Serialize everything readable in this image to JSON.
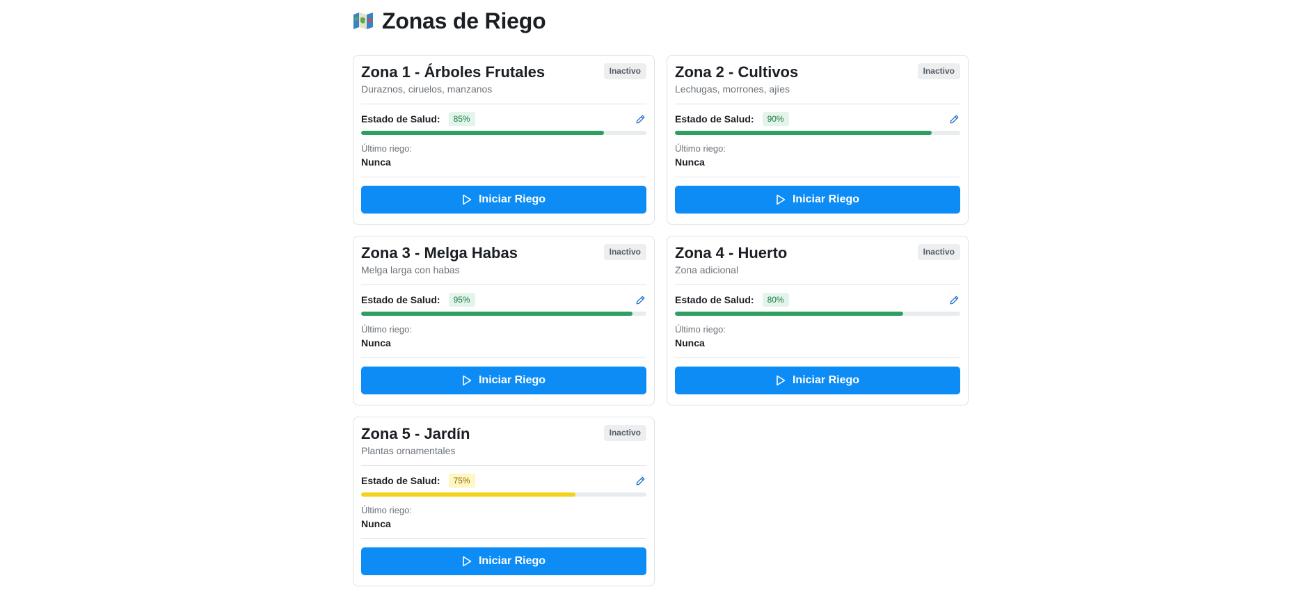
{
  "page": {
    "title": "Zonas de Riego",
    "icon": "map-icon"
  },
  "colors": {
    "primary_button": "#0d8cf6",
    "health_good": "#2e9e63",
    "health_warn": "#f3d21b",
    "badge_inactive_bg": "#eceef0"
  },
  "labels": {
    "health": "Estado de Salud:",
    "last_watering": "Último riego:",
    "start_button": "Iniciar Riego",
    "edit_icon": "pencil-icon",
    "play_icon": "play-icon"
  },
  "zones": [
    {
      "name": "Zona 1 - Árboles Frutales",
      "description": "Duraznos, ciruelos, manzanos",
      "status": "Inactivo",
      "health_text": "85%",
      "health": 85,
      "health_level": "good",
      "last_watering": "Nunca"
    },
    {
      "name": "Zona 2 - Cultivos",
      "description": "Lechugas, morrones, ajíes",
      "status": "Inactivo",
      "health_text": "90%",
      "health": 90,
      "health_level": "good",
      "last_watering": "Nunca"
    },
    {
      "name": "Zona 3 - Melga Habas",
      "description": "Melga larga con habas",
      "status": "Inactivo",
      "health_text": "95%",
      "health": 95,
      "health_level": "good",
      "last_watering": "Nunca"
    },
    {
      "name": "Zona 4 - Huerto",
      "description": "Zona adicional",
      "status": "Inactivo",
      "health_text": "80%",
      "health": 80,
      "health_level": "good",
      "last_watering": "Nunca"
    },
    {
      "name": "Zona 5 - Jardín",
      "description": "Plantas ornamentales",
      "status": "Inactivo",
      "health_text": "75%",
      "health": 75,
      "health_level": "warn",
      "last_watering": "Nunca"
    }
  ]
}
